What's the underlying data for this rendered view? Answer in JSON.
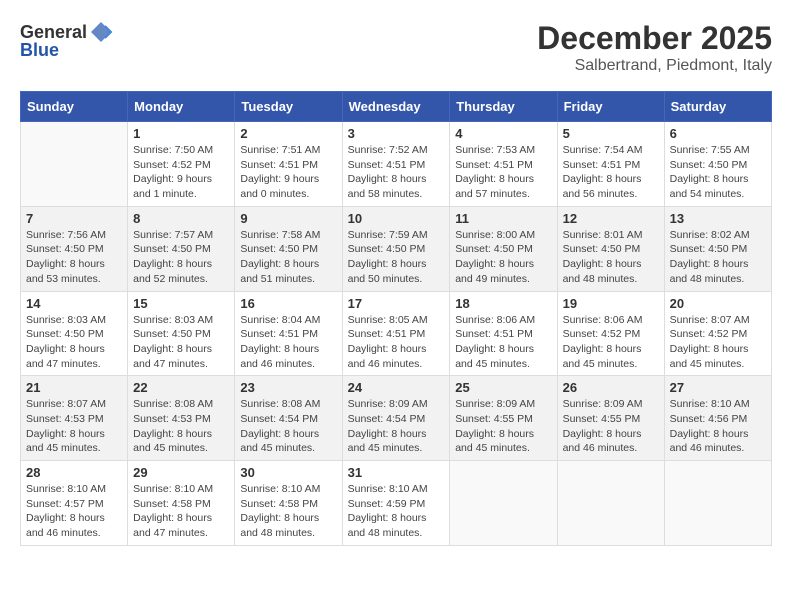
{
  "header": {
    "logo_general": "General",
    "logo_blue": "Blue",
    "month": "December 2025",
    "location": "Salbertrand, Piedmont, Italy"
  },
  "days_of_week": [
    "Sunday",
    "Monday",
    "Tuesday",
    "Wednesday",
    "Thursday",
    "Friday",
    "Saturday"
  ],
  "weeks": [
    [
      {
        "day": "",
        "info": ""
      },
      {
        "day": "1",
        "info": "Sunrise: 7:50 AM\nSunset: 4:52 PM\nDaylight: 9 hours\nand 1 minute."
      },
      {
        "day": "2",
        "info": "Sunrise: 7:51 AM\nSunset: 4:51 PM\nDaylight: 9 hours\nand 0 minutes."
      },
      {
        "day": "3",
        "info": "Sunrise: 7:52 AM\nSunset: 4:51 PM\nDaylight: 8 hours\nand 58 minutes."
      },
      {
        "day": "4",
        "info": "Sunrise: 7:53 AM\nSunset: 4:51 PM\nDaylight: 8 hours\nand 57 minutes."
      },
      {
        "day": "5",
        "info": "Sunrise: 7:54 AM\nSunset: 4:51 PM\nDaylight: 8 hours\nand 56 minutes."
      },
      {
        "day": "6",
        "info": "Sunrise: 7:55 AM\nSunset: 4:50 PM\nDaylight: 8 hours\nand 54 minutes."
      }
    ],
    [
      {
        "day": "7",
        "info": "Sunrise: 7:56 AM\nSunset: 4:50 PM\nDaylight: 8 hours\nand 53 minutes."
      },
      {
        "day": "8",
        "info": "Sunrise: 7:57 AM\nSunset: 4:50 PM\nDaylight: 8 hours\nand 52 minutes."
      },
      {
        "day": "9",
        "info": "Sunrise: 7:58 AM\nSunset: 4:50 PM\nDaylight: 8 hours\nand 51 minutes."
      },
      {
        "day": "10",
        "info": "Sunrise: 7:59 AM\nSunset: 4:50 PM\nDaylight: 8 hours\nand 50 minutes."
      },
      {
        "day": "11",
        "info": "Sunrise: 8:00 AM\nSunset: 4:50 PM\nDaylight: 8 hours\nand 49 minutes."
      },
      {
        "day": "12",
        "info": "Sunrise: 8:01 AM\nSunset: 4:50 PM\nDaylight: 8 hours\nand 48 minutes."
      },
      {
        "day": "13",
        "info": "Sunrise: 8:02 AM\nSunset: 4:50 PM\nDaylight: 8 hours\nand 48 minutes."
      }
    ],
    [
      {
        "day": "14",
        "info": "Sunrise: 8:03 AM\nSunset: 4:50 PM\nDaylight: 8 hours\nand 47 minutes."
      },
      {
        "day": "15",
        "info": "Sunrise: 8:03 AM\nSunset: 4:50 PM\nDaylight: 8 hours\nand 47 minutes."
      },
      {
        "day": "16",
        "info": "Sunrise: 8:04 AM\nSunset: 4:51 PM\nDaylight: 8 hours\nand 46 minutes."
      },
      {
        "day": "17",
        "info": "Sunrise: 8:05 AM\nSunset: 4:51 PM\nDaylight: 8 hours\nand 46 minutes."
      },
      {
        "day": "18",
        "info": "Sunrise: 8:06 AM\nSunset: 4:51 PM\nDaylight: 8 hours\nand 45 minutes."
      },
      {
        "day": "19",
        "info": "Sunrise: 8:06 AM\nSunset: 4:52 PM\nDaylight: 8 hours\nand 45 minutes."
      },
      {
        "day": "20",
        "info": "Sunrise: 8:07 AM\nSunset: 4:52 PM\nDaylight: 8 hours\nand 45 minutes."
      }
    ],
    [
      {
        "day": "21",
        "info": "Sunrise: 8:07 AM\nSunset: 4:53 PM\nDaylight: 8 hours\nand 45 minutes."
      },
      {
        "day": "22",
        "info": "Sunrise: 8:08 AM\nSunset: 4:53 PM\nDaylight: 8 hours\nand 45 minutes."
      },
      {
        "day": "23",
        "info": "Sunrise: 8:08 AM\nSunset: 4:54 PM\nDaylight: 8 hours\nand 45 minutes."
      },
      {
        "day": "24",
        "info": "Sunrise: 8:09 AM\nSunset: 4:54 PM\nDaylight: 8 hours\nand 45 minutes."
      },
      {
        "day": "25",
        "info": "Sunrise: 8:09 AM\nSunset: 4:55 PM\nDaylight: 8 hours\nand 45 minutes."
      },
      {
        "day": "26",
        "info": "Sunrise: 8:09 AM\nSunset: 4:55 PM\nDaylight: 8 hours\nand 46 minutes."
      },
      {
        "day": "27",
        "info": "Sunrise: 8:10 AM\nSunset: 4:56 PM\nDaylight: 8 hours\nand 46 minutes."
      }
    ],
    [
      {
        "day": "28",
        "info": "Sunrise: 8:10 AM\nSunset: 4:57 PM\nDaylight: 8 hours\nand 46 minutes."
      },
      {
        "day": "29",
        "info": "Sunrise: 8:10 AM\nSunset: 4:58 PM\nDaylight: 8 hours\nand 47 minutes."
      },
      {
        "day": "30",
        "info": "Sunrise: 8:10 AM\nSunset: 4:58 PM\nDaylight: 8 hours\nand 48 minutes."
      },
      {
        "day": "31",
        "info": "Sunrise: 8:10 AM\nSunset: 4:59 PM\nDaylight: 8 hours\nand 48 minutes."
      },
      {
        "day": "",
        "info": ""
      },
      {
        "day": "",
        "info": ""
      },
      {
        "day": "",
        "info": ""
      }
    ]
  ]
}
